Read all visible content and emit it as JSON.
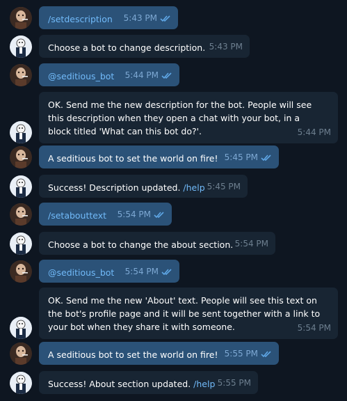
{
  "messages": [
    {
      "dir": "out",
      "parts": [
        {
          "text": "/setdescription",
          "cmd": true
        }
      ],
      "time": "5:43 PM",
      "read": true
    },
    {
      "dir": "in",
      "parts": [
        {
          "text": "Choose a bot to change description.",
          "cmd": false
        }
      ],
      "time": "5:43 PM"
    },
    {
      "dir": "out",
      "parts": [
        {
          "text": "@seditious_bot",
          "cmd": true
        }
      ],
      "time": "5:44 PM",
      "read": true
    },
    {
      "dir": "in",
      "parts": [
        {
          "text": "OK. Send me the new description for the bot. People will see this description when they open a chat with your bot, in a block titled 'What can this bot do?'.",
          "cmd": false
        }
      ],
      "time": "5:44 PM"
    },
    {
      "dir": "out",
      "parts": [
        {
          "text": "A seditious bot to set the world on fire!",
          "cmd": false
        }
      ],
      "time": "5:45 PM",
      "read": true
    },
    {
      "dir": "in",
      "parts": [
        {
          "text": "Success! Description updated. ",
          "cmd": false
        },
        {
          "text": "/help",
          "cmd": true
        }
      ],
      "time": "5:45 PM"
    },
    {
      "dir": "out",
      "parts": [
        {
          "text": "/setabouttext",
          "cmd": true
        }
      ],
      "time": "5:54 PM",
      "read": true
    },
    {
      "dir": "in",
      "parts": [
        {
          "text": "Choose a bot to change the about section.",
          "cmd": false
        }
      ],
      "time": "5:54 PM"
    },
    {
      "dir": "out",
      "parts": [
        {
          "text": "@seditious_bot",
          "cmd": true
        }
      ],
      "time": "5:54 PM",
      "read": true
    },
    {
      "dir": "in",
      "parts": [
        {
          "text": "OK. Send me the new 'About' text. People will see this text on the bot's profile page and it will be sent together with a link to your bot when they share it with someone.",
          "cmd": false
        }
      ],
      "time": "5:54 PM"
    },
    {
      "dir": "out",
      "parts": [
        {
          "text": "A seditious bot to set the world on fire!",
          "cmd": false
        }
      ],
      "time": "5:55 PM",
      "read": true
    },
    {
      "dir": "in",
      "parts": [
        {
          "text": "Success! About section updated. ",
          "cmd": false
        },
        {
          "text": "/help",
          "cmd": true
        }
      ],
      "time": "5:55 PM"
    }
  ],
  "colors": {
    "background": "#0e1621",
    "outgoing_bubble": "#2b5278",
    "incoming_bubble": "#182533",
    "link": "#71baf9"
  }
}
